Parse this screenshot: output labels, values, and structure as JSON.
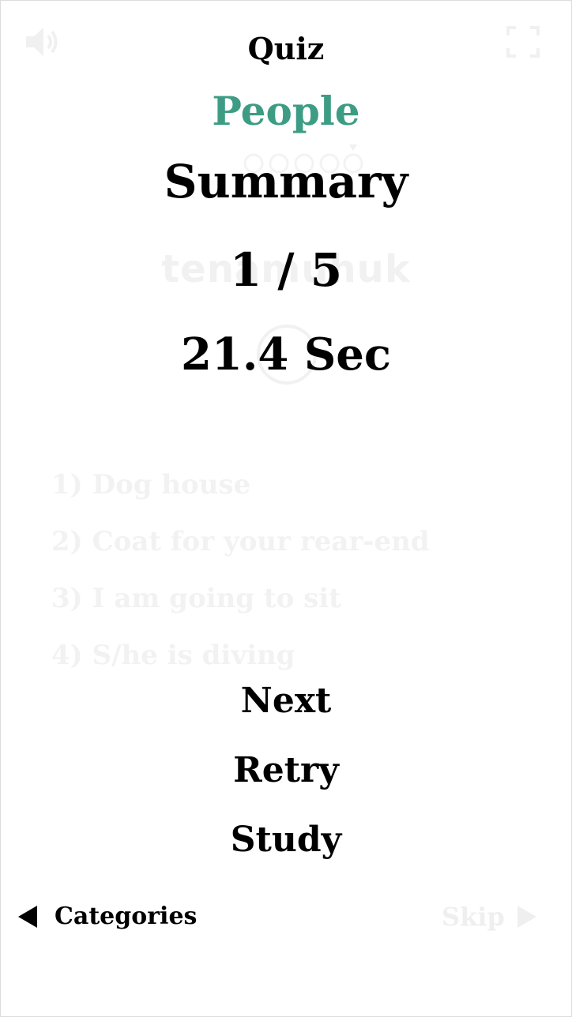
{
  "header": {
    "title": "Quiz",
    "category": "People",
    "sound_icon": "speaker-icon",
    "fullscreen_icon": "fullscreen-icon"
  },
  "summary": {
    "heading": "Summary",
    "score": "1 / 5",
    "time": "21.4 Sec"
  },
  "background": {
    "word": "tenamuhuk",
    "options": [
      "1) Dog house",
      "2) Coat for your rear-end",
      "3) I am going to sit",
      "4) S/he is diving"
    ]
  },
  "actions": {
    "next_label": "Next",
    "retry_label": "Retry",
    "study_label": "Study"
  },
  "footer": {
    "categories_label": "Categories",
    "skip_label": "Skip"
  },
  "colors": {
    "accent": "#3d9c84",
    "faded": "#f1f1f1",
    "text": "#000000"
  }
}
